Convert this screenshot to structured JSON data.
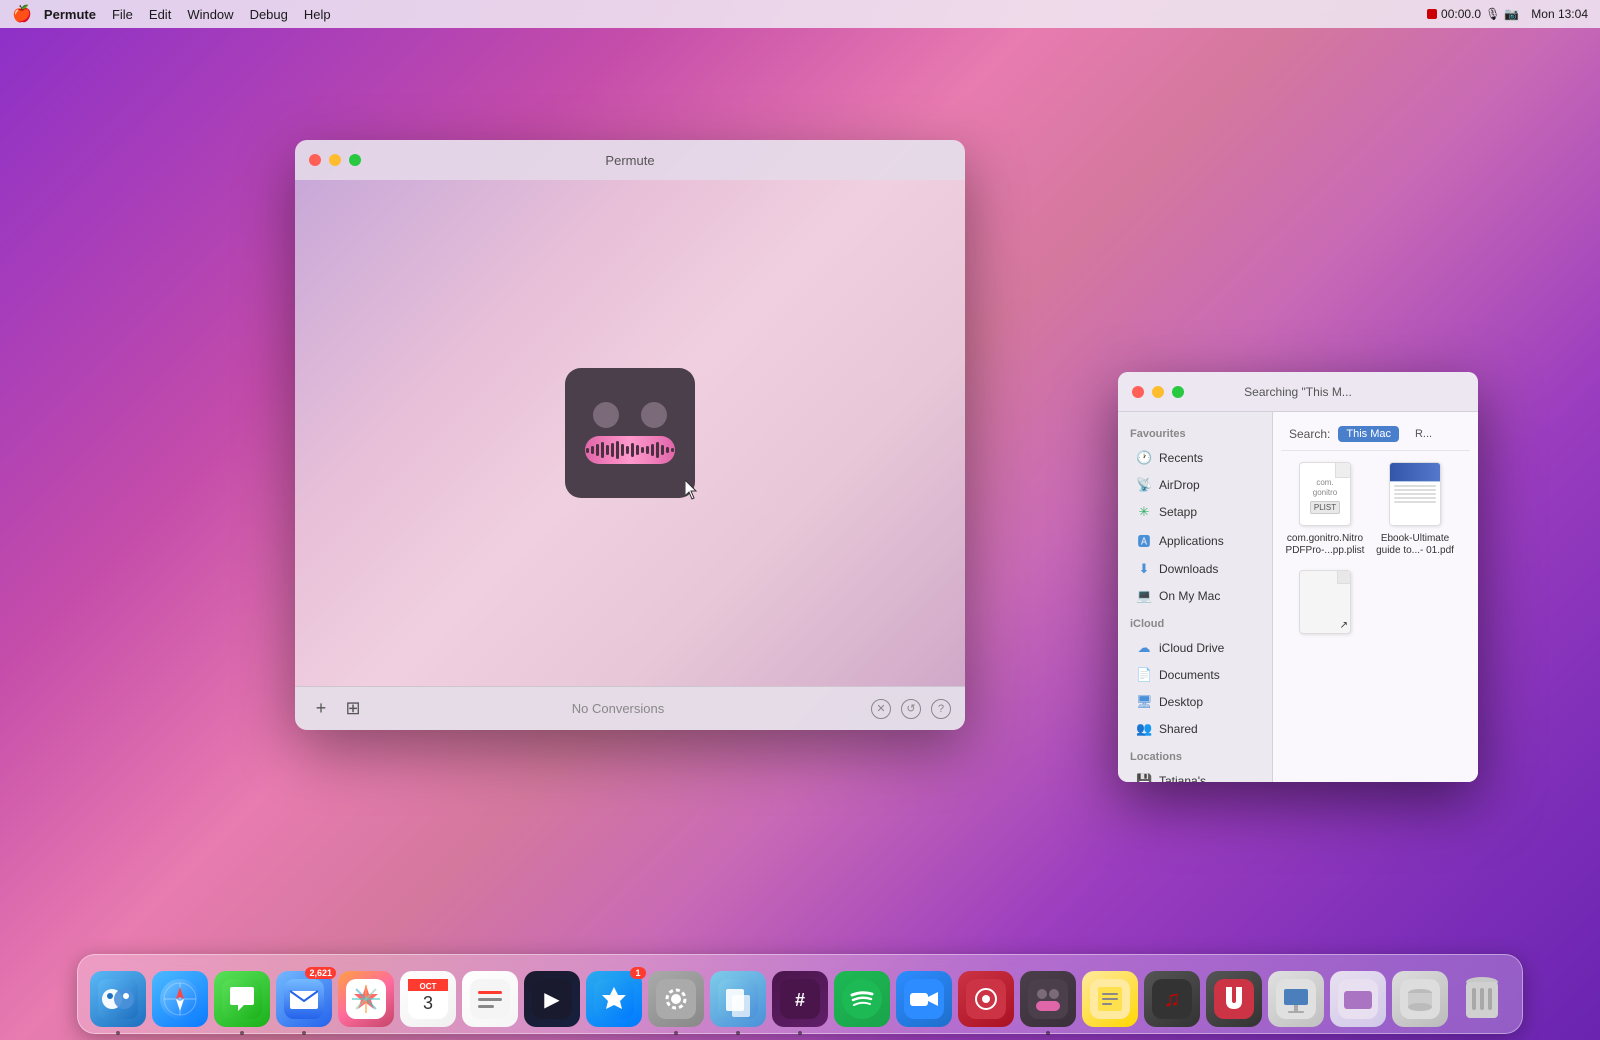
{
  "menubar": {
    "apple": "🍎",
    "app_name": "Permute",
    "items": [
      "File",
      "Edit",
      "Window",
      "Debug",
      "Help"
    ],
    "right": {
      "recording": "00:00.0",
      "time": "Mon 13:04"
    }
  },
  "permute_window": {
    "title": "Permute",
    "no_conversions": "No Conversions",
    "toolbar_plus": "+",
    "traffic_lights": [
      "close",
      "minimize",
      "maximize"
    ]
  },
  "finder_window": {
    "title": "Searching \"This M...",
    "search_label": "Search:",
    "search_scope_this_mac": "This Mac",
    "search_scope_recents": "R...",
    "sidebar": {
      "favourites_label": "Favourites",
      "items": [
        {
          "icon": "🕐",
          "label": "Recents",
          "icon_class": "clock"
        },
        {
          "icon": "📡",
          "label": "AirDrop",
          "icon_class": "blue2"
        },
        {
          "icon": "✳️",
          "label": "Setapp",
          "icon_class": "green"
        },
        {
          "icon": "🅰",
          "label": "Applications",
          "icon_class": "blue2"
        },
        {
          "icon": "⬇",
          "label": "Downloads",
          "icon_class": "blue2"
        },
        {
          "icon": "💻",
          "label": "On My Mac",
          "icon_class": "gray"
        }
      ],
      "icloud_label": "iCloud",
      "icloud_items": [
        {
          "label": "iCloud Drive"
        },
        {
          "label": "Documents"
        },
        {
          "label": "Desktop"
        },
        {
          "label": "Shared"
        }
      ],
      "locations_label": "Locations",
      "locations_items": [
        {
          "label": "Tatiana's..."
        }
      ]
    },
    "files": [
      {
        "name": "com.gonitro.Nitro PDFPro-...pp.plist",
        "type": "plist"
      },
      {
        "name": "Ebook-Ultimate guide to...- 01.pdf",
        "type": "pdf"
      },
      {
        "name": "",
        "type": "blank"
      }
    ]
  },
  "dock": {
    "apps": [
      {
        "name": "Finder",
        "class": "di-finder",
        "emoji": "🔵",
        "active": true
      },
      {
        "name": "Safari",
        "class": "di-safari",
        "emoji": "🧭",
        "active": false
      },
      {
        "name": "Messages",
        "class": "di-messages",
        "emoji": "💬",
        "active": true
      },
      {
        "name": "Mail",
        "class": "di-mail",
        "emoji": "✉️",
        "badge": "2,621",
        "active": true
      },
      {
        "name": "Photos",
        "class": "di-photos",
        "emoji": "🌸",
        "active": false
      },
      {
        "name": "Calendar",
        "class": "di-calendar",
        "emoji": "📅",
        "badge": "OCT",
        "active": false
      },
      {
        "name": "Reminders",
        "class": "di-reminders",
        "emoji": "📝",
        "active": false
      },
      {
        "name": "Apple TV",
        "class": "di-tv",
        "emoji": "📺",
        "active": false
      },
      {
        "name": "App Store",
        "class": "di-appstore",
        "emoji": "🅰",
        "badge": "1",
        "active": false
      },
      {
        "name": "System Settings",
        "class": "di-settings",
        "emoji": "⚙️",
        "active": true
      },
      {
        "name": "Preview",
        "class": "di-preview",
        "emoji": "🖼",
        "active": true
      },
      {
        "name": "Slack",
        "class": "di-slack",
        "emoji": "#",
        "active": true
      },
      {
        "name": "Spotify",
        "class": "di-spotify",
        "emoji": "♪",
        "active": false
      },
      {
        "name": "Zoom",
        "class": "di-zoom",
        "emoji": "📹",
        "active": false
      },
      {
        "name": "Notchmeister",
        "class": "di-notch",
        "emoji": "🔴",
        "active": false
      },
      {
        "name": "Permute",
        "class": "di-permute",
        "emoji": "🤖",
        "active": true
      },
      {
        "name": "Notes",
        "class": "di-notes",
        "emoji": "📋",
        "active": false
      },
      {
        "name": "Scrobbles",
        "class": "di-scrobbles",
        "emoji": "♫",
        "active": false
      },
      {
        "name": "Magnet",
        "class": "di-magnet",
        "emoji": "🔲",
        "active": false
      },
      {
        "name": "Keynote",
        "class": "di-keynote",
        "emoji": "K",
        "active": false
      },
      {
        "name": "Slides",
        "class": "di-slides",
        "emoji": "◼",
        "active": false
      },
      {
        "name": "Canister",
        "class": "di-canister",
        "emoji": "🗑",
        "active": false
      },
      {
        "name": "Trash",
        "class": "di-trash",
        "emoji": "🗑️",
        "active": false
      }
    ]
  },
  "waveform_bars": [
    2,
    5,
    8,
    12,
    16,
    10,
    14,
    18,
    12,
    8,
    14,
    10,
    6,
    8,
    12,
    16,
    10,
    6,
    4,
    2
  ]
}
